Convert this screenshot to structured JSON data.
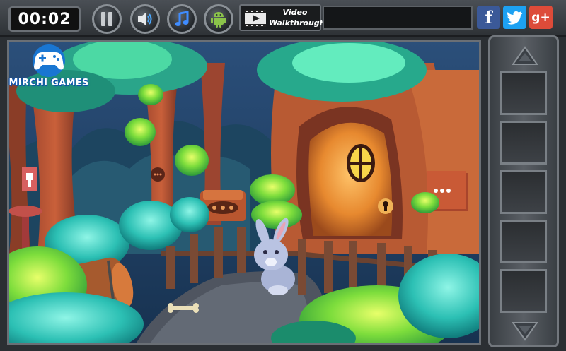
{
  "hud": {
    "timer": "00:02",
    "walkthrough_line1": "Video",
    "walkthrough_line2": "Walkthrough"
  },
  "social": {
    "facebook": "f",
    "google_plus": "g+"
  },
  "logo": {
    "text": "MIRCHI GAMES"
  },
  "inventory": {
    "slot_count": 5
  }
}
